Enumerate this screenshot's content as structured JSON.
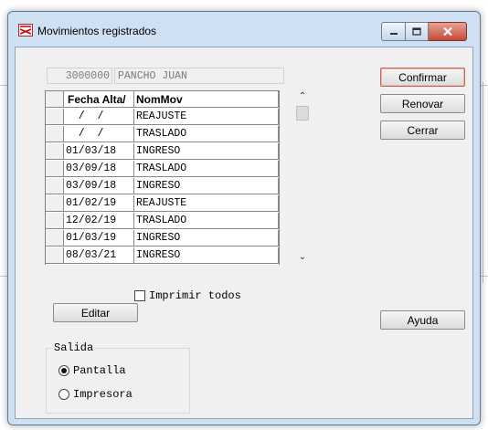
{
  "window": {
    "title": "Movimientos registrados"
  },
  "header": {
    "code": "3000000",
    "name": "PANCHO JUAN"
  },
  "grid": {
    "columns": [
      "Fecha Alta/",
      "NomMov"
    ],
    "rows": [
      {
        "fecha": "  /  /",
        "nommov": "REAJUSTE"
      },
      {
        "fecha": "  /  /",
        "nommov": "TRASLADO"
      },
      {
        "fecha": "01/03/18",
        "nommov": "INGRESO"
      },
      {
        "fecha": "03/09/18",
        "nommov": "TRASLADO"
      },
      {
        "fecha": "03/09/18",
        "nommov": "INGRESO"
      },
      {
        "fecha": "01/02/19",
        "nommov": "REAJUSTE"
      },
      {
        "fecha": "12/02/19",
        "nommov": "TRASLADO"
      },
      {
        "fecha": "01/03/19",
        "nommov": "INGRESO"
      },
      {
        "fecha": "08/03/21",
        "nommov": "INGRESO"
      }
    ]
  },
  "buttons": {
    "confirmar": "Confirmar",
    "renovar": "Renovar",
    "cerrar": "Cerrar",
    "editar": "Editar",
    "ayuda": "Ayuda"
  },
  "print_all": {
    "label": "Imprimir todos",
    "checked": false
  },
  "salida": {
    "label": "Salida",
    "options": [
      {
        "label": "Pantalla",
        "selected": true
      },
      {
        "label": "Impresora",
        "selected": false
      }
    ]
  },
  "icons": {
    "app": "app-logo-icon",
    "minimize": "minimize-icon",
    "maximize": "maximize-icon",
    "close": "close-icon",
    "scroll_up": "chevron-up-icon",
    "scroll_down": "chevron-down-icon"
  },
  "colors": {
    "window_frame": "#cfe0f3",
    "close_button": "#c44a35",
    "default_button_border": "#c2685c"
  }
}
